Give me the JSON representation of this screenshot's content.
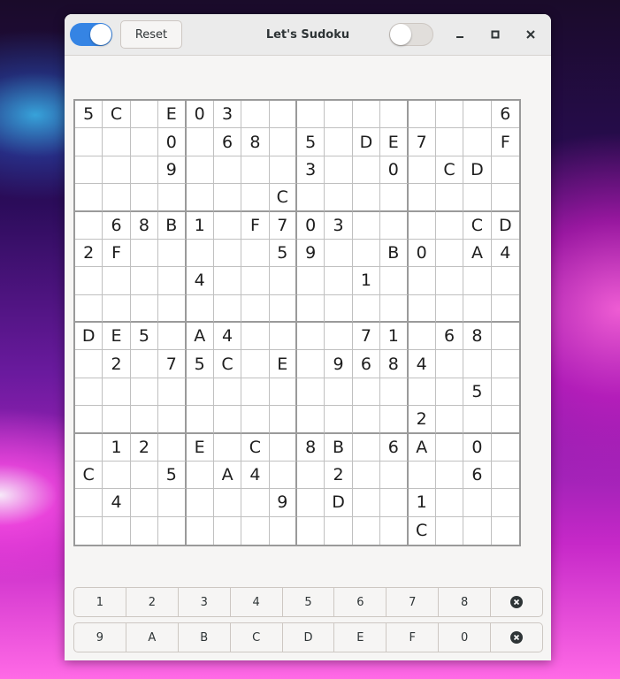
{
  "window": {
    "title": "Let's Sudoku",
    "reset_label": "Reset",
    "left_toggle_on": true,
    "right_toggle_on": false
  },
  "grid_size": 16,
  "box_size": 4,
  "board": [
    [
      "5",
      "C",
      "",
      "E",
      "0",
      "3",
      "",
      "",
      "",
      "",
      "",
      "",
      "",
      "",
      "",
      "6"
    ],
    [
      "",
      "",
      "",
      "0",
      "",
      "6",
      "8",
      "",
      "5",
      "",
      "D",
      "E",
      "7",
      "",
      "",
      "F"
    ],
    [
      "",
      "",
      "",
      "9",
      "",
      "",
      "",
      "",
      "3",
      "",
      "",
      "0",
      "",
      "C",
      "D",
      ""
    ],
    [
      "",
      "",
      "",
      "",
      "",
      "",
      "",
      "C",
      "",
      "",
      "",
      "",
      "",
      "",
      "",
      ""
    ],
    [
      "",
      "6",
      "8",
      "B",
      "1",
      "",
      "F",
      "7",
      "0",
      "3",
      "",
      "",
      "",
      "",
      "C",
      "D"
    ],
    [
      "2",
      "F",
      "",
      "",
      "",
      "",
      "",
      "5",
      "9",
      "",
      "",
      "B",
      "0",
      "",
      "A",
      "4"
    ],
    [
      "",
      "",
      "",
      "",
      "4",
      "",
      "",
      "",
      "",
      "",
      "1",
      "",
      "",
      "",
      "",
      ""
    ],
    [
      "",
      "",
      "",
      "",
      "",
      "",
      "",
      "",
      "",
      "",
      "",
      "",
      "",
      "",
      "",
      ""
    ],
    [
      "D",
      "E",
      "5",
      "",
      "A",
      "4",
      "",
      "",
      "",
      "",
      "7",
      "1",
      "",
      "6",
      "8",
      ""
    ],
    [
      "",
      "2",
      "",
      "7",
      "5",
      "C",
      "",
      "E",
      "",
      "9",
      "6",
      "8",
      "4",
      "",
      "",
      ""
    ],
    [
      "",
      "",
      "",
      "",
      "",
      "",
      "",
      "",
      "",
      "",
      "",
      "",
      "",
      "",
      "5",
      ""
    ],
    [
      "",
      "",
      "",
      "",
      "",
      "",
      "",
      "",
      "",
      "",
      "",
      "",
      "2",
      "",
      "",
      ""
    ],
    [
      "",
      "1",
      "2",
      "",
      "E",
      "",
      "C",
      "",
      "8",
      "B",
      "",
      "6",
      "A",
      "",
      "0",
      ""
    ],
    [
      "C",
      "",
      "",
      "5",
      "",
      "A",
      "4",
      "",
      "",
      "2",
      "",
      "",
      "",
      "",
      "6",
      ""
    ],
    [
      "",
      "4",
      "",
      "",
      "",
      "",
      "",
      "9",
      "",
      "D",
      "",
      "",
      "1",
      "",
      "",
      ""
    ],
    [
      "",
      "",
      "",
      "",
      "",
      "",
      "",
      "",
      "",
      "",
      "",
      "",
      "C",
      "",
      "",
      ""
    ]
  ],
  "keypad": {
    "row1": [
      "1",
      "2",
      "3",
      "4",
      "5",
      "6",
      "7",
      "8"
    ],
    "row2": [
      "9",
      "A",
      "B",
      "C",
      "D",
      "E",
      "F",
      "0"
    ]
  },
  "icons": {
    "clear": "clear-icon",
    "minimize": "minimize-icon",
    "maximize": "maximize-icon",
    "close": "close-icon"
  },
  "colors": {
    "accent": "#3584e4",
    "grid_line": "#c0c0c0",
    "box_line": "#9a9a9a"
  }
}
